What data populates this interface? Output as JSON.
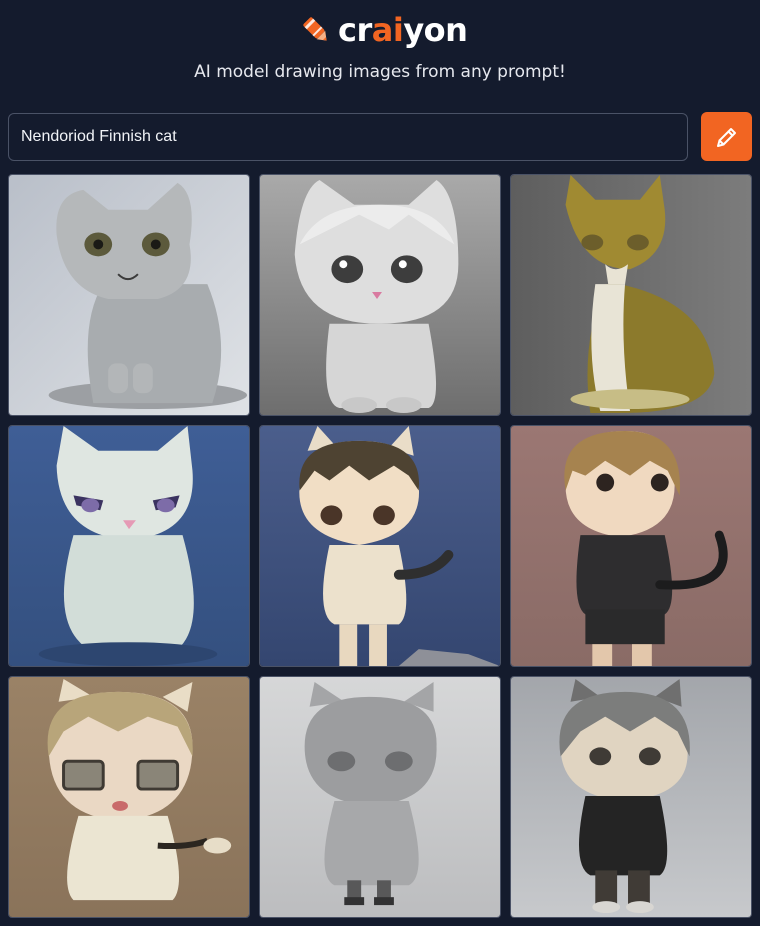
{
  "header": {
    "logo": {
      "prefix": "cr",
      "highlight": "ai",
      "suffix": "yon"
    },
    "tagline": "AI model drawing images from any prompt!"
  },
  "prompt": {
    "value": "Nendoriod Finnish cat",
    "draw_button_icon": "pencil-icon"
  },
  "colors": {
    "background": "#141b2d",
    "accent": "#f26522",
    "border": "#4a5266"
  },
  "images": [
    {
      "subject": "gray cat figurine with yellow eyes"
    },
    {
      "subject": "gray chibi cat with big dark eyes"
    },
    {
      "subject": "olive-tan cat figurine with white chest"
    },
    {
      "subject": "white cat figurine with purple eyes on blue fabric"
    },
    {
      "subject": "brown-haired cat-ear figure in cream sweater"
    },
    {
      "subject": "light-brown-haired figure in dark shirt with black tail"
    },
    {
      "subject": "cat-ear figure with glasses in cream dress"
    },
    {
      "subject": "gray cat-headed figure in gray dress"
    },
    {
      "subject": "gray-haired cat-ear figure in black outfit"
    }
  ]
}
